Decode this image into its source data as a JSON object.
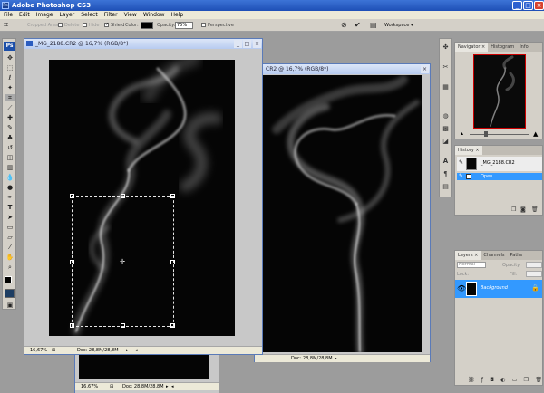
{
  "app": {
    "title": "Adobe Photoshop CS3",
    "logo": "Ps"
  },
  "window_controls": {
    "minimize": "_",
    "maximize": "□",
    "close": "×"
  },
  "menu": [
    "File",
    "Edit",
    "Image",
    "Layer",
    "Select",
    "Filter",
    "View",
    "Window",
    "Help"
  ],
  "options": {
    "cropped_area_label": "Cropped Area:",
    "delete_label": "Delete",
    "hide_label": "Hide",
    "shield_label": "Shield",
    "color_label": "Color:",
    "opacity_label": "Opacity:",
    "opacity_value": "75%",
    "perspective_label": "Perspective",
    "workspace_label": "Workspace"
  },
  "documents": {
    "front": {
      "title": "_MG_2188.CR2 @ 16,7% (RGB/8*)",
      "zoom": "16,67%",
      "doc_size": "Doc: 28,8M/28,8M"
    },
    "middle": {
      "title": "CR2 @ 16,7% (RGB/8*)",
      "doc_size": "Doc: 28,8M/28,8M"
    },
    "back": {
      "zoom": "16,67%",
      "doc_size": "Doc: 28,8M/28,8M"
    }
  },
  "navigator": {
    "tabs": [
      "Navigator ×",
      "Histogram",
      "Info"
    ]
  },
  "history": {
    "tabs": [
      "History ×"
    ],
    "snapshot": "_MG_2188.CR2",
    "items": [
      "Open"
    ]
  },
  "layers": {
    "tabs": [
      "Layers ×",
      "Channels",
      "Paths"
    ],
    "blend_mode": "Normal",
    "opacity_label": "Opacity:",
    "fill_label": "Fill:",
    "lock_label": "Lock:",
    "layer_name": "Background"
  },
  "colors": {
    "titlebar": "#2a5fc8",
    "selection": "#3399ff",
    "canvas": "#050505",
    "workspace": "#9c9c9c"
  }
}
